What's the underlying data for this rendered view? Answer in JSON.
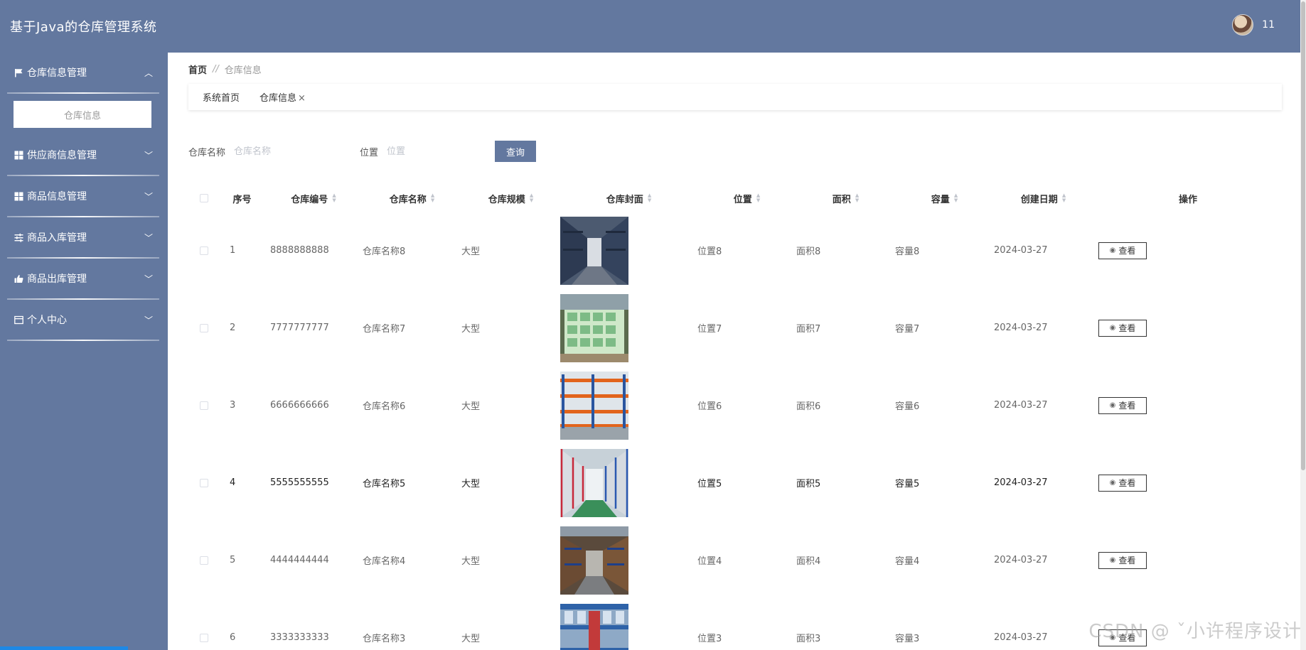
{
  "header": {
    "app_title": "基于Java的仓库管理系统",
    "username": "11"
  },
  "sidebar": {
    "groups": [
      {
        "label": "仓库信息管理",
        "icon": "flag-icon",
        "expanded": true,
        "subitems": [
          "仓库信息"
        ]
      },
      {
        "label": "供应商信息管理",
        "icon": "grid-icon"
      },
      {
        "label": "商品信息管理",
        "icon": "grid-icon"
      },
      {
        "label": "商品入库管理",
        "icon": "sliders-icon"
      },
      {
        "label": "商品出库管理",
        "icon": "thumb-up-icon"
      },
      {
        "label": "个人中心",
        "icon": "card-icon"
      }
    ]
  },
  "breadcrumb": {
    "home": "首页",
    "separator": "//",
    "current": "仓库信息"
  },
  "tabs": [
    {
      "label": "系统首页"
    },
    {
      "label": "仓库信息",
      "close": "×"
    }
  ],
  "search": {
    "fields": [
      {
        "label": "仓库名称",
        "placeholder": "仓库名称"
      },
      {
        "label": "位置",
        "placeholder": "位置"
      }
    ],
    "button": "查询"
  },
  "table": {
    "headers": [
      "序号",
      "仓库编号",
      "仓库名称",
      "仓库规模",
      "仓库封面",
      "位置",
      "面积",
      "容量",
      "创建日期",
      "操作"
    ],
    "rows": [
      {
        "idx": "1",
        "code": "8888888888",
        "name": "仓库名称8",
        "scale": "大型",
        "location": "位置8",
        "area": "面积8",
        "capacity": "容量8",
        "date": "2024-03-27",
        "action": "查看"
      },
      {
        "idx": "2",
        "code": "7777777777",
        "name": "仓库名称7",
        "scale": "大型",
        "location": "位置7",
        "area": "面积7",
        "capacity": "容量7",
        "date": "2024-03-27",
        "action": "查看"
      },
      {
        "idx": "3",
        "code": "6666666666",
        "name": "仓库名称6",
        "scale": "大型",
        "location": "位置6",
        "area": "面积6",
        "capacity": "容量6",
        "date": "2024-03-27",
        "action": "查看"
      },
      {
        "idx": "4",
        "code": "5555555555",
        "name": "仓库名称5",
        "scale": "大型",
        "location": "位置5",
        "area": "面积5",
        "capacity": "容量5",
        "date": "2024-03-27",
        "action": "查看"
      },
      {
        "idx": "5",
        "code": "4444444444",
        "name": "仓库名称4",
        "scale": "大型",
        "location": "位置4",
        "area": "面积4",
        "capacity": "容量4",
        "date": "2024-03-27",
        "action": "查看"
      },
      {
        "idx": "6",
        "code": "3333333333",
        "name": "仓库名称3",
        "scale": "大型",
        "location": "位置3",
        "area": "面积3",
        "capacity": "容量3",
        "date": "2024-03-27",
        "action": "查看"
      }
    ]
  },
  "watermark": "CSDN @ ˇ小许程序设计",
  "colors": {
    "primary": "#63789f",
    "accent_strip": "#1e88e5"
  }
}
